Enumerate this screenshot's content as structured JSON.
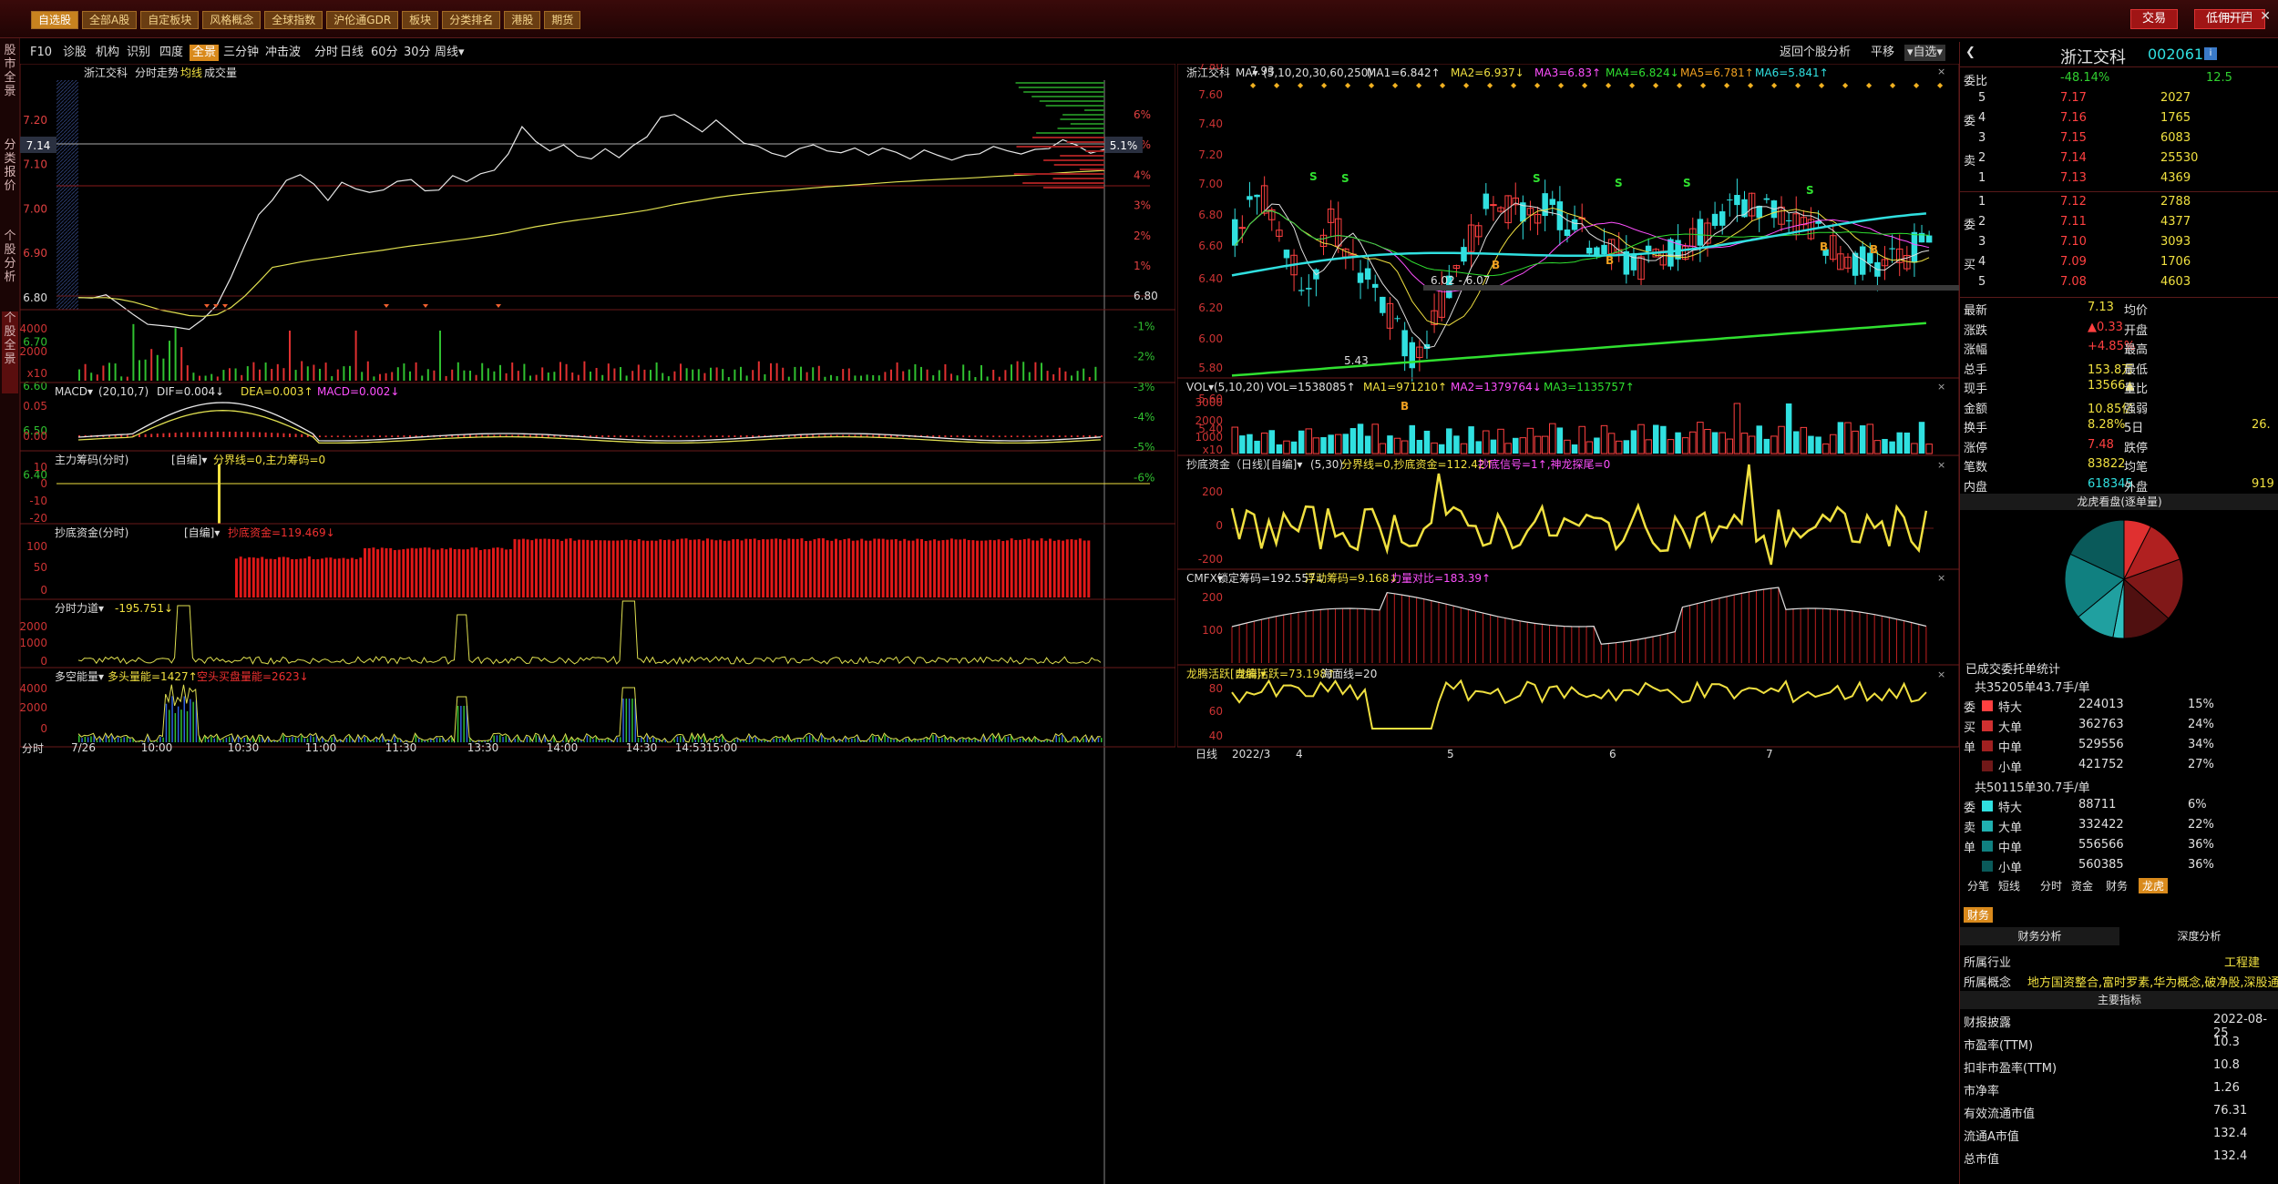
{
  "topbar": {
    "buttons": [
      "自选股",
      "全部A股",
      "自定板块",
      "风格概念",
      "全球指数",
      "沪伦通GDR",
      "板块",
      "分类排名",
      "港股",
      "期货"
    ],
    "trade_btn": "交易",
    "open_btn": "低佣开户",
    "win_controls": [
      "—",
      "□",
      "✕"
    ]
  },
  "leftnav": [
    "股市全景",
    "分类报价",
    "个股分析",
    "个股全景"
  ],
  "tabs": [
    "F10",
    "诊股",
    "机构",
    "识别",
    "四度",
    "全景",
    "三分钟",
    "冲击波",
    "分时",
    "日线",
    "60分",
    "30分",
    "周线▾"
  ],
  "tabs_right": [
    "返回个股分析",
    "平移",
    "▾自选▾"
  ],
  "intraday": {
    "title": "浙江交科",
    "subtitle": "分时走势",
    "avgline": "均线",
    "volume_label": "成交量",
    "price_ticks": [
      "7.20",
      "7.10",
      "7.00",
      "6.90",
      "6.80",
      "6.70",
      "6.60",
      "6.50",
      "6.40"
    ],
    "pct_ticks": [
      "6%",
      "5%",
      "4%",
      "3%",
      "2%",
      "1%",
      "6.80",
      "-1%",
      "-2%",
      "-3%",
      "-4%",
      "-5%",
      "-6%"
    ],
    "current_price": "7.14",
    "current_pct": "5.1%",
    "vol_ticks": [
      "4000",
      "2000",
      "x10"
    ],
    "time_ticks": [
      "7/26",
      "10:00",
      "10:30",
      "11:00",
      "11:30",
      "13:30",
      "14:00",
      "14:30",
      "14:53",
      "15:00"
    ],
    "bottom_left": "分时"
  },
  "macd": {
    "title": "MACD▾",
    "params": "(20,10,7)",
    "dif": "DIF=0.004↓",
    "dea": "DEA=0.003↑",
    "macd": "MACD=0.002↓",
    "ticks": [
      "0.05",
      "0.00"
    ]
  },
  "zl": {
    "title": "主力筹码(分时)",
    "sub": "[自编]▾",
    "text": "分界线=0,主力筹码=0",
    "ticks": [
      "10",
      "0",
      "-10",
      "-20"
    ]
  },
  "cd": {
    "title": "抄底资金(分时)",
    "sub": "[自编]▾",
    "text": "抄底资金=119.469↓",
    "ticks": [
      "100",
      "50",
      "0"
    ]
  },
  "fs": {
    "title": "分时力道▾",
    "text": "-195.751↓",
    "ticks": [
      "2000",
      "1000",
      "0"
    ]
  },
  "dk": {
    "title": "多空能量▾",
    "text1": "多头量能=1427↑",
    "text2": "空头买盘量能=2623↓",
    "ticks": [
      "4000",
      "2000",
      "0"
    ]
  },
  "kline": {
    "title": "浙江交科",
    "ma": "MA▾",
    "params": "(5,10,20,30,60,250)",
    "ma1": "MA1=6.842↑",
    "ma2": "MA2=6.937↓",
    "ma3": "MA3=6.83↑",
    "ma4": "MA4=6.824↓",
    "ma5": "MA5=6.781↑",
    "ma6": "MA6=5.841↑",
    "ticks": [
      "7.80",
      "7.60",
      "7.40",
      "7.20",
      "7.00",
      "6.80",
      "6.60",
      "6.40",
      "6.20",
      "6.00",
      "5.80",
      "5.60",
      "5.40"
    ],
    "hi": "7.93",
    "lo": "5.43",
    "range_label": "6.02 - 6.07",
    "months": [
      "2022/3",
      "4",
      "5",
      "6",
      "7"
    ],
    "bottom_left": "日线"
  },
  "vol": {
    "title": "VOL▾",
    "params": "(5,10,20)",
    "v": "VOL=1538085↑",
    "m1": "MA1=971210↑",
    "m2": "MA2=1379764↓",
    "m3": "MA3=1135757↑",
    "ticks": [
      "3000",
      "2000",
      "1000",
      "x10"
    ]
  },
  "cdd": {
    "title": "抄底资金（日线）",
    "sub": "[自编]▾",
    "params": "(5,30)",
    "text1": "分界线=0,抄底资金=112.42↑",
    "text2": "抄底信号=1↑,神龙探尾=0",
    "ticks": [
      "200",
      "0",
      "-200"
    ]
  },
  "cmfx": {
    "title": "CMFX▾",
    "t1": "锁定筹码=192.557↓",
    "t2": "浮动筹码=9.168↓",
    "t3": "力量对比=183.39↑",
    "ticks": [
      "200",
      "100"
    ]
  },
  "lthy": {
    "title": "龙腾活跃[自编]▾",
    "t1": "龙腾活跃=73.198↑",
    "t2": "海面线=20",
    "ticks": [
      "80",
      "60",
      "40"
    ]
  },
  "right": {
    "name": "浙江交科",
    "code": "002061",
    "weibi_label": "委比",
    "weibi": "-48.14%",
    "weicha": "12.5",
    "sell": [
      [
        "5",
        "7.17",
        "2027"
      ],
      [
        "4",
        "7.16",
        "1765"
      ],
      [
        "3",
        "7.15",
        "6083"
      ],
      [
        "2",
        "7.14",
        "25530"
      ],
      [
        "1",
        "7.13",
        "4369"
      ]
    ],
    "buy": [
      [
        "1",
        "7.12",
        "2788"
      ],
      [
        "2",
        "7.11",
        "4377"
      ],
      [
        "3",
        "7.10",
        "3093"
      ],
      [
        "4",
        "7.09",
        "1706"
      ],
      [
        "5",
        "7.08",
        "4603"
      ]
    ],
    "sell_side": [
      "委",
      "卖",
      "单"
    ],
    "buy_side": [
      "委",
      "买",
      "单"
    ],
    "stats": [
      [
        "最新",
        "7.13",
        "均价",
        ""
      ],
      [
        "涨跌",
        "▲0.33",
        "开盘",
        ""
      ],
      [
        "涨幅",
        "+4.85%",
        "最高",
        ""
      ],
      [
        "总手",
        "153.8万",
        "最低",
        ""
      ],
      [
        "现手",
        "13566▲",
        "量比",
        ""
      ],
      [
        "金额",
        "10.85亿",
        "强弱",
        ""
      ],
      [
        "换手",
        "8.28%",
        "5日",
        "26."
      ],
      [
        "涨停",
        "7.48",
        "跌停",
        ""
      ],
      [
        "笔数",
        "83822",
        "均笔",
        ""
      ],
      [
        "内盘",
        "618345",
        "外盘",
        "919"
      ]
    ],
    "lhk": "龙虎看盘(逐单量)",
    "deal_title": "已成交委托单统计",
    "buy_total": "共35205单43.7手/单",
    "buy_rows": [
      [
        "特大",
        "224013",
        "15%"
      ],
      [
        "大单",
        "362763",
        "24%"
      ],
      [
        "中单",
        "529556",
        "34%"
      ],
      [
        "小单",
        "421752",
        "27%"
      ]
    ],
    "sell_total": "共50115单30.7手/单",
    "sell_rows": [
      [
        "特大",
        "88711",
        "6%"
      ],
      [
        "大单",
        "332422",
        "22%"
      ],
      [
        "中单",
        "556566",
        "36%"
      ],
      [
        "小单",
        "560385",
        "36%"
      ]
    ],
    "tabs": [
      "分笔",
      "短线",
      "分时",
      "资金",
      "财务",
      "龙虎"
    ],
    "fin_tab": "财务",
    "fin_sub": [
      "财务分析",
      "深度分析"
    ],
    "industry_label": "所属行业",
    "industry": "工程建",
    "concept_label": "所属概念",
    "concept": "地方国资整合,富时罗素,华为概念,破净股,深股通",
    "main_index": "主要指标",
    "fin": [
      [
        "财报披露",
        "2022-08-25"
      ],
      [
        "市盈率(TTM)",
        "10.3"
      ],
      [
        "扣非市盈率(TTM)",
        "10.8"
      ],
      [
        "市净率",
        "1.26"
      ],
      [
        "有效流通市值",
        "76.31"
      ],
      [
        "流通A市值",
        "132.4"
      ],
      [
        "总市值",
        "132.4"
      ]
    ]
  }
}
